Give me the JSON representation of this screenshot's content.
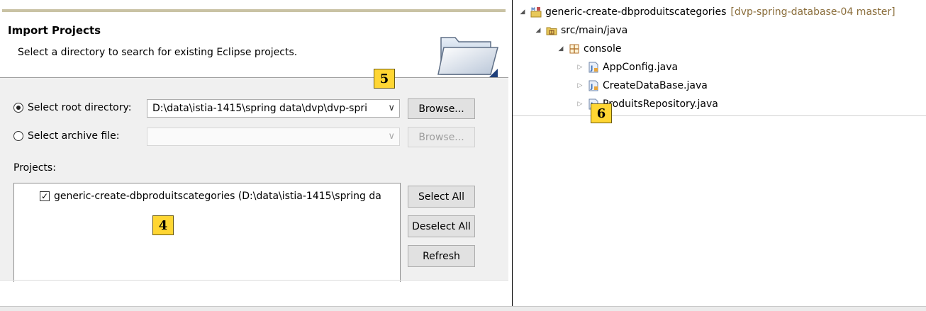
{
  "dialog": {
    "title": "Import Projects",
    "description": "Select a directory to search for existing Eclipse projects.",
    "root_directory_label": "Select root directory:",
    "root_directory_value": "D:\\data\\istia-1415\\spring data\\dvp\\dvp-spri",
    "archive_file_label": "Select archive file:",
    "archive_file_value": "",
    "browse_label": "Browse...",
    "projects_label": "Projects:",
    "projects": [
      {
        "label": "generic-create-dbproduitscategories (D:\\data\\istia-1415\\spring da",
        "checked": true
      }
    ],
    "select_all_label": "Select All",
    "deselect_all_label": "Deselect All",
    "refresh_label": "Refresh"
  },
  "badges": {
    "b4": "4",
    "b5": "5",
    "b6": "6"
  },
  "tree": {
    "project_name": "generic-create-dbproduitscategories",
    "project_repo": "[dvp-spring-database-04 master]",
    "source_folder": "src/main/java",
    "package": "console",
    "files": [
      "AppConfig.java",
      "CreateDataBase.java",
      "ProduitsRepository.java"
    ]
  },
  "colors": {
    "badge": "#ffd633",
    "folder": "#e8c85a",
    "java": "#3b6fb6"
  }
}
